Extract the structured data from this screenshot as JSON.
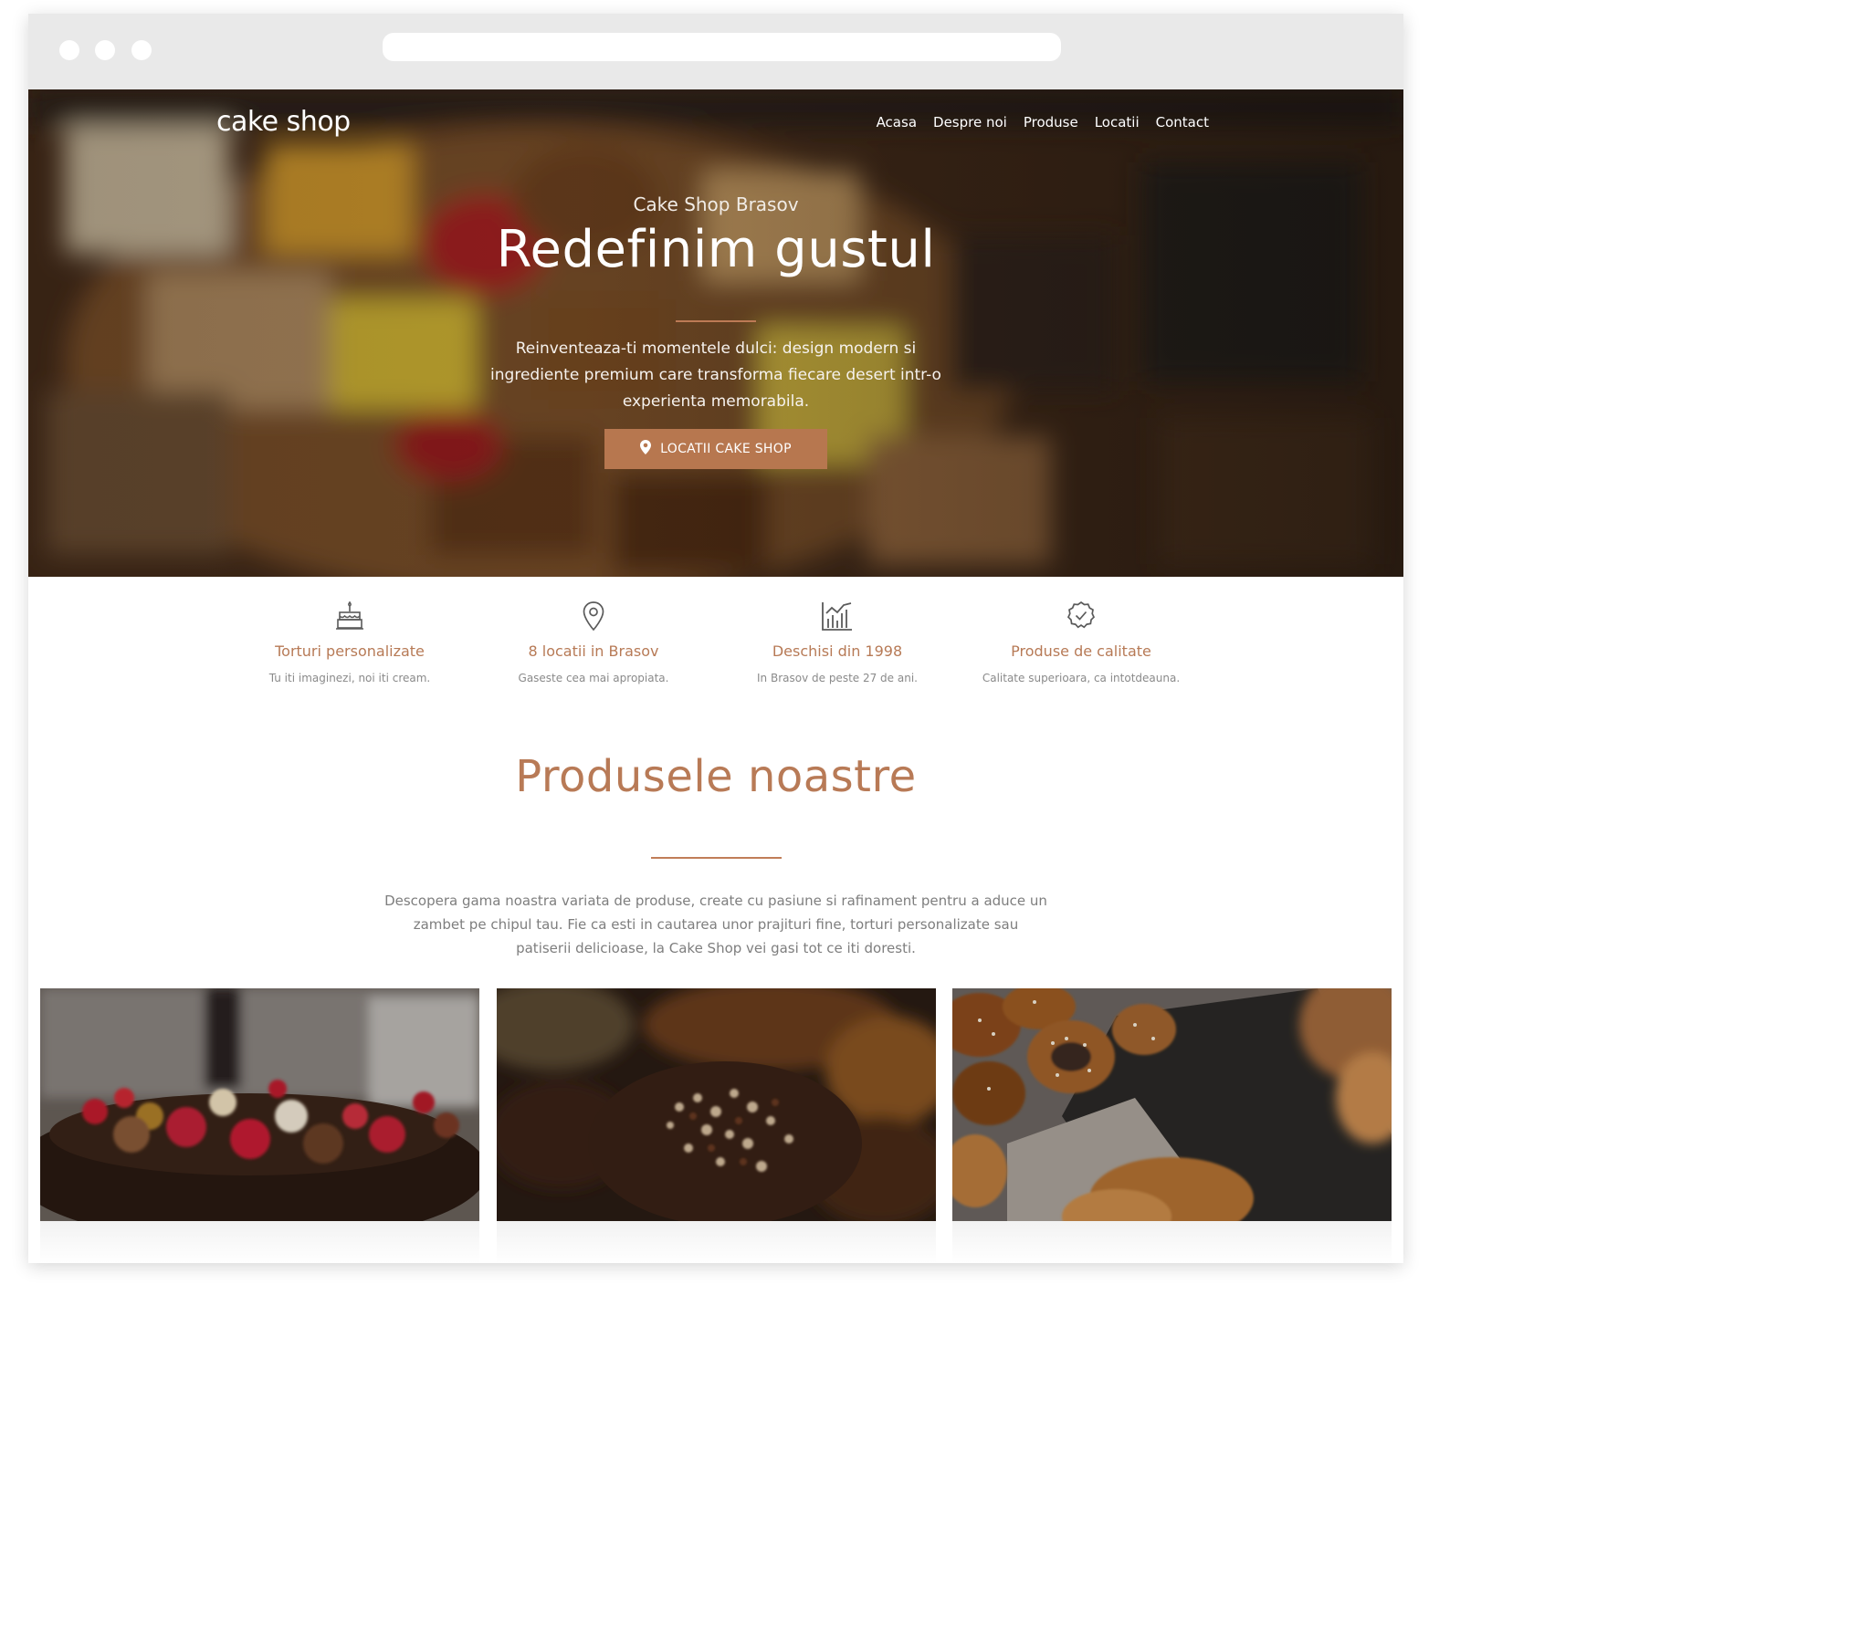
{
  "brand": {
    "logo_text": "cake shop",
    "accent": "#b7774f"
  },
  "nav": {
    "items": [
      "Acasa",
      "Despre noi",
      "Produse",
      "Locatii",
      "Contact"
    ]
  },
  "hero": {
    "kicker": "Cake Shop Brasov",
    "title": "Redefinim gustul",
    "subtitle": "Reinventeaza-ti momentele dulci: design modern si ingrediente premium care transforma fiecare desert intr-o experienta memorabila.",
    "button_label": "LOCATII CAKE SHOP",
    "button_icon": "map-pin-icon"
  },
  "features": [
    {
      "icon": "cake-icon",
      "title": "Torturi personalizate",
      "text": "Tu iti imaginezi, noi iti cream."
    },
    {
      "icon": "map-pin-icon",
      "title": "8 locatii in Brasov",
      "text": "Gaseste cea mai apropiata."
    },
    {
      "icon": "bar-chart-icon",
      "title": "Deschisi din 1998",
      "text": "In Brasov de peste 27 de ani."
    },
    {
      "icon": "check-badge-icon",
      "title": "Produse de calitate",
      "text": "Calitate superioara, ca intotdeauna."
    }
  ],
  "products": {
    "title": "Produsele noastre",
    "description": "Descopera gama noastra variata de produse, create cu pasiune si rafinament pentru a aduce un zambet pe chipul tau. Fie ca esti in cautarea unor prajituri fine, torturi personalizate sau patiserii delicioase, la Cake Shop vei gasi tot ce iti doresti."
  }
}
